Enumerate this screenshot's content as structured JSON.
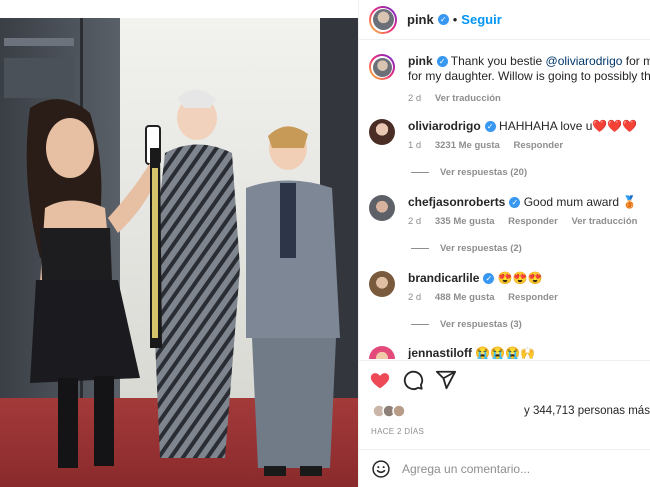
{
  "header": {
    "username": "pink",
    "follow_label": "Seguir",
    "dot": "•"
  },
  "caption": {
    "username": "pink",
    "text_line1_pre": "Thank you bestie ",
    "mention": "@oliviarodrigo",
    "text_line1_post": " for making",
    "text_line2": "for my daughter. Willow is going to possibly throw u",
    "time": "2 d",
    "translate": "Ver traducción"
  },
  "comments": [
    {
      "username": "oliviarodrigo",
      "text": "HAHHAHA love u",
      "emoji": "❤️❤️❤️",
      "time": "1 d",
      "likes": "3231 Me gusta",
      "reply": "Responder",
      "translate": "",
      "replies": "Ver respuestas (20)"
    },
    {
      "username": "chefjasonroberts",
      "text": "Good mum award",
      "emoji": "🥉",
      "time": "2 d",
      "likes": "335 Me gusta",
      "reply": "Responder",
      "translate": "Ver traducción",
      "replies": "Ver respuestas (2)"
    },
    {
      "username": "brandicarlile",
      "text": "",
      "emoji": "😍😍😍",
      "time": "2 d",
      "likes": "488 Me gusta",
      "reply": "Responder",
      "translate": "",
      "replies": "Ver respuestas (3)"
    },
    {
      "username": "jennastiloff",
      "text": "",
      "emoji": "😭😭😭🙌",
      "time": "",
      "likes": "",
      "reply": "",
      "translate": "",
      "replies": ""
    }
  ],
  "actions": {
    "like_icon": "heart-icon",
    "comment_icon": "comment-icon",
    "share_icon": "share-icon",
    "likes_count_text": "y 344,713 personas más",
    "date": "HACE 2 DÍAS"
  },
  "add_comment": {
    "placeholder": "Agrega un comentario..."
  },
  "colors": {
    "accent": "#0095f6",
    "verified": "#3897f0",
    "like_red": "#ed4956",
    "mention": "#00376b",
    "muted": "#8e8e8e"
  }
}
